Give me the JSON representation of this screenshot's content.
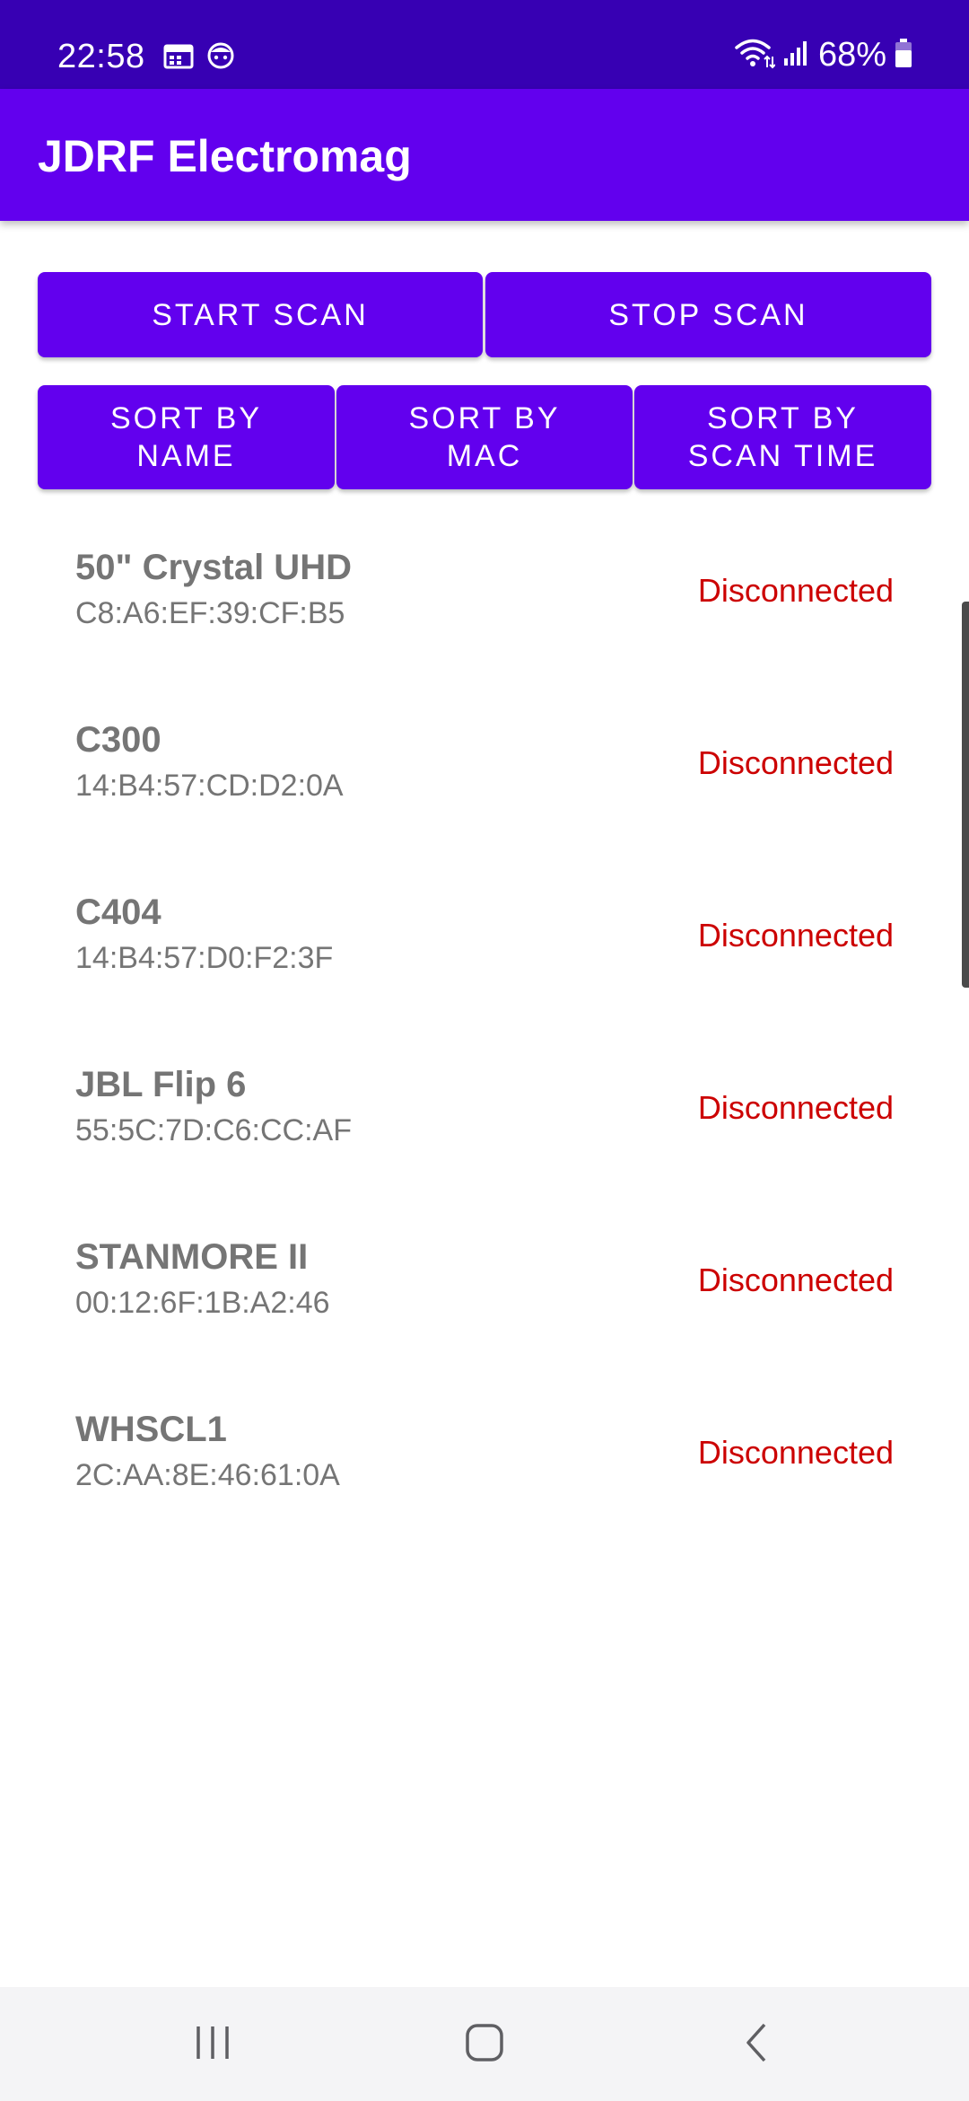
{
  "status_bar": {
    "time": "22:58",
    "battery": "68%",
    "left_icons": [
      "calendar-icon",
      "notification-face-icon"
    ],
    "right_icons": [
      "wifi-icon",
      "signal-icon",
      "battery-icon"
    ]
  },
  "app_bar": {
    "title": "JDRF Electromag"
  },
  "buttons": {
    "start_scan": "START SCAN",
    "stop_scan": "STOP SCAN",
    "sort_by_name": "SORT BY\nNAME",
    "sort_by_mac": "SORT BY\nMAC",
    "sort_by_scan_time": "SORT BY\nSCAN TIME"
  },
  "devices": [
    {
      "name": "50\" Crystal UHD",
      "mac": "C8:A6:EF:39:CF:B5",
      "status": "Disconnected"
    },
    {
      "name": "C300",
      "mac": "14:B4:57:CD:D2:0A",
      "status": "Disconnected"
    },
    {
      "name": "C404",
      "mac": "14:B4:57:D0:F2:3F",
      "status": "Disconnected"
    },
    {
      "name": "JBL Flip 6",
      "mac": "55:5C:7D:C6:CC:AF",
      "status": "Disconnected"
    },
    {
      "name": "STANMORE II",
      "mac": "00:12:6F:1B:A2:46",
      "status": "Disconnected"
    },
    {
      "name": "WHSCL1",
      "mac": "2C:AA:8E:46:61:0A",
      "status": "Disconnected"
    }
  ],
  "nav_bar": {
    "icons": [
      "recents-icon",
      "home-icon",
      "back-icon"
    ]
  },
  "colors": {
    "status_bar": "#3700b3",
    "primary": "#6200ee",
    "disconnected": "#cc0000",
    "device_text": "#757575"
  }
}
